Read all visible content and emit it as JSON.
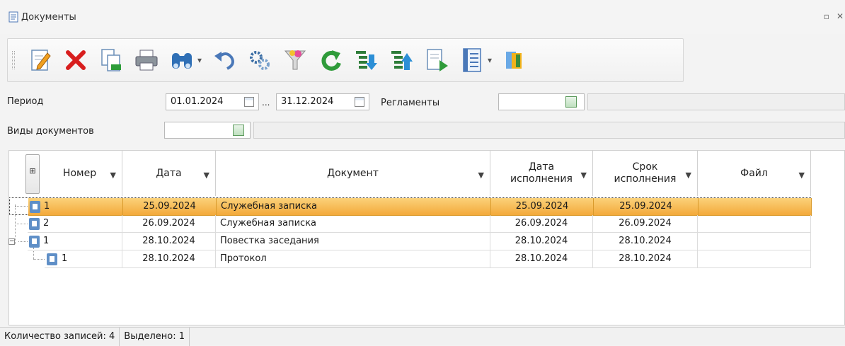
{
  "window": {
    "title": "Документы"
  },
  "toolbar": {
    "buttons": [
      {
        "name": "edit-icon"
      },
      {
        "name": "delete-icon"
      },
      {
        "name": "copy-icon"
      },
      {
        "name": "print-icon"
      },
      {
        "name": "search-binoculars-icon"
      },
      {
        "name": "undo-icon"
      },
      {
        "name": "settings-icon"
      },
      {
        "name": "filter-icon"
      },
      {
        "name": "refresh-icon"
      },
      {
        "name": "export-icon"
      },
      {
        "name": "import-icon"
      },
      {
        "name": "document-forward-icon"
      },
      {
        "name": "list-icon"
      },
      {
        "name": "exit-icon"
      }
    ]
  },
  "filters": {
    "period_label": "Период",
    "date_from": "01.01.2024",
    "range_sep": "...",
    "date_to": "31.12.2024",
    "reglaments_label": "Регламенты",
    "doc_types_label": "Виды документов"
  },
  "grid": {
    "columns": [
      "Номер",
      "Дата",
      "Документ",
      "Дата\nисполнения",
      "Срок\nисполнения",
      "Файл"
    ],
    "rows": [
      {
        "number": "1",
        "date": "25.09.2024",
        "document": "Служебная записка",
        "exec_date": "25.09.2024",
        "deadline": "25.09.2024",
        "file": ""
      },
      {
        "number": "2",
        "date": "26.09.2024",
        "document": "Служебная записка",
        "exec_date": "26.09.2024",
        "deadline": "26.09.2024",
        "file": ""
      },
      {
        "number": "1",
        "date": "28.10.2024",
        "document": "Повестка заседания",
        "exec_date": "28.10.2024",
        "deadline": "28.10.2024",
        "file": ""
      },
      {
        "number": "1",
        "date": "28.10.2024",
        "document": "Протокол",
        "exec_date": "28.10.2024",
        "deadline": "28.10.2024",
        "file": ""
      }
    ],
    "selected_row": 0,
    "selection_color": "#f5b041"
  },
  "status": {
    "records": "Количество записей: 4",
    "selected": "Выделено: 1"
  }
}
